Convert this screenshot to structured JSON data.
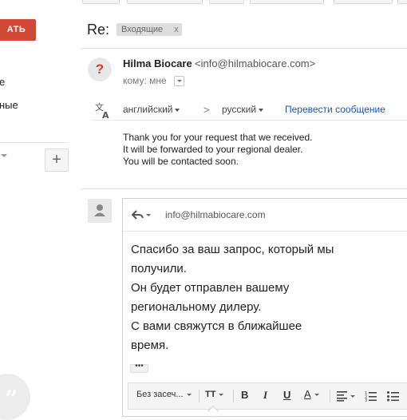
{
  "sidebar": {
    "compose_label": "АТЬ",
    "items": [
      {
        "label": "е"
      },
      {
        "label": "ные"
      }
    ],
    "add_symbol": "+"
  },
  "message": {
    "subject_prefix": "Re:",
    "label": "Входящие",
    "label_remove": "x",
    "sender_name": "Hilma Biocare",
    "sender_email": "<info@hilmabiocare.com>",
    "to_line": "кому: мне",
    "body_lines": [
      "Thank you for your request that we received.",
      "It will be forwarded to your regional dealer.",
      "You will be contacted soon."
    ]
  },
  "translate_bar": {
    "from_lang": "английский",
    "arrow": ">",
    "to_lang": "русский",
    "action": "Перевести сообщение"
  },
  "reply": {
    "to": "info@hilmabiocare.com",
    "lines": [
      "Спасибо за ваш запрос, который мы",
      "получили.",
      "Он будет отправлен вашему",
      "региональному дилеру.",
      "С вами свяжутся в ближайшее",
      "время."
    ],
    "more": "•••",
    "toolbar": {
      "font": "Без засеч...",
      "size_icon": "TT",
      "bold": "B",
      "italic": "I",
      "underline": "U",
      "text_color": "A"
    }
  },
  "colors": {
    "compose": "#d14836",
    "link": "#1155cc",
    "unknown_sender": "#dd3a2f"
  }
}
